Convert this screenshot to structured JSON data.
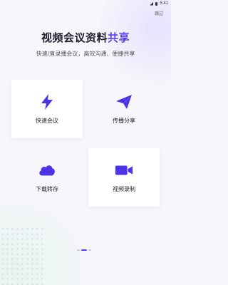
{
  "status": {
    "time": "5:41"
  },
  "skip_label": "跳过",
  "title": {
    "main": "视频会议资料",
    "accent": "共享"
  },
  "subtitle": "快速/直录播会议，高效沟通、便捷共享",
  "cards": [
    {
      "label": "快速会议",
      "icon": "lightning-icon"
    },
    {
      "label": "传播分享",
      "icon": "paper-plane-icon"
    },
    {
      "label": "下载转存",
      "icon": "cloud-icon"
    },
    {
      "label": "视频录制",
      "icon": "video-camera-icon"
    }
  ],
  "pager": {
    "count": 3,
    "active": 1
  },
  "colors": {
    "accent": "#5a3df0",
    "icon": "#4b33e6"
  }
}
